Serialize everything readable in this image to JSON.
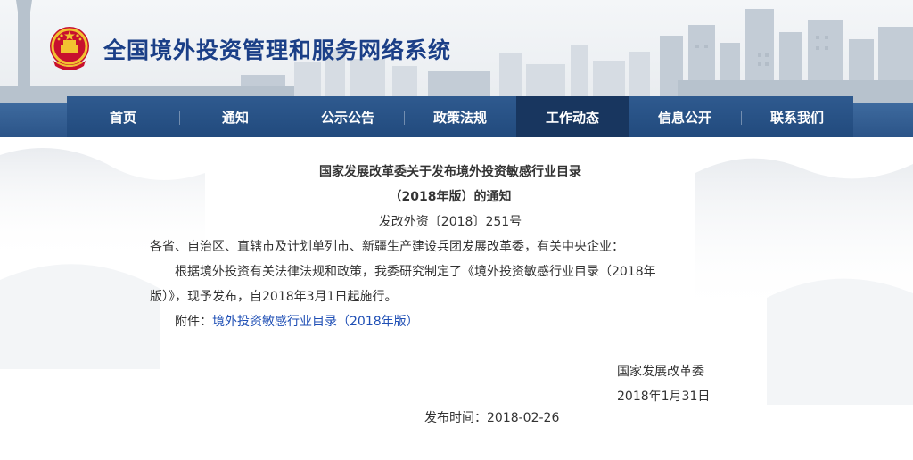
{
  "site": {
    "title": "全国境外投资管理和服务网络系统"
  },
  "nav": {
    "items": [
      {
        "label": "首页"
      },
      {
        "label": "通知"
      },
      {
        "label": "公示公告"
      },
      {
        "label": "政策法规"
      },
      {
        "label": "工作动态"
      },
      {
        "label": "信息公开"
      },
      {
        "label": "联系我们"
      }
    ],
    "active": "工作动态"
  },
  "article": {
    "title_line1": "国家发展改革委关于发布境外投资敏感行业目录",
    "title_line2": "（2018年版）的通知",
    "doc_number": "发改外资〔2018〕251号",
    "recipients": "各省、自治区、直辖市及计划单列市、新疆生产建设兵团发展改革委，有关中央企业：",
    "body_line1": "根据境外投资有关法律法规和政策，我委研究制定了《境外投资敏感行业目录（2018年",
    "body_line2": "版）》，现予发布，自2018年3月1日起施行。",
    "attachment_label": "附件：",
    "attachment_link": "境外投资敏感行业目录（2018年版）",
    "signature_org": "国家发展改革委",
    "signature_date": "2018年1月31日",
    "publish_label": "发布时间：",
    "publish_date": "2018-02-26"
  },
  "colors": {
    "title": "#1b3f87",
    "nav": "#2b5488",
    "nav_active": "#18365f",
    "link": "#1f4fb5"
  }
}
